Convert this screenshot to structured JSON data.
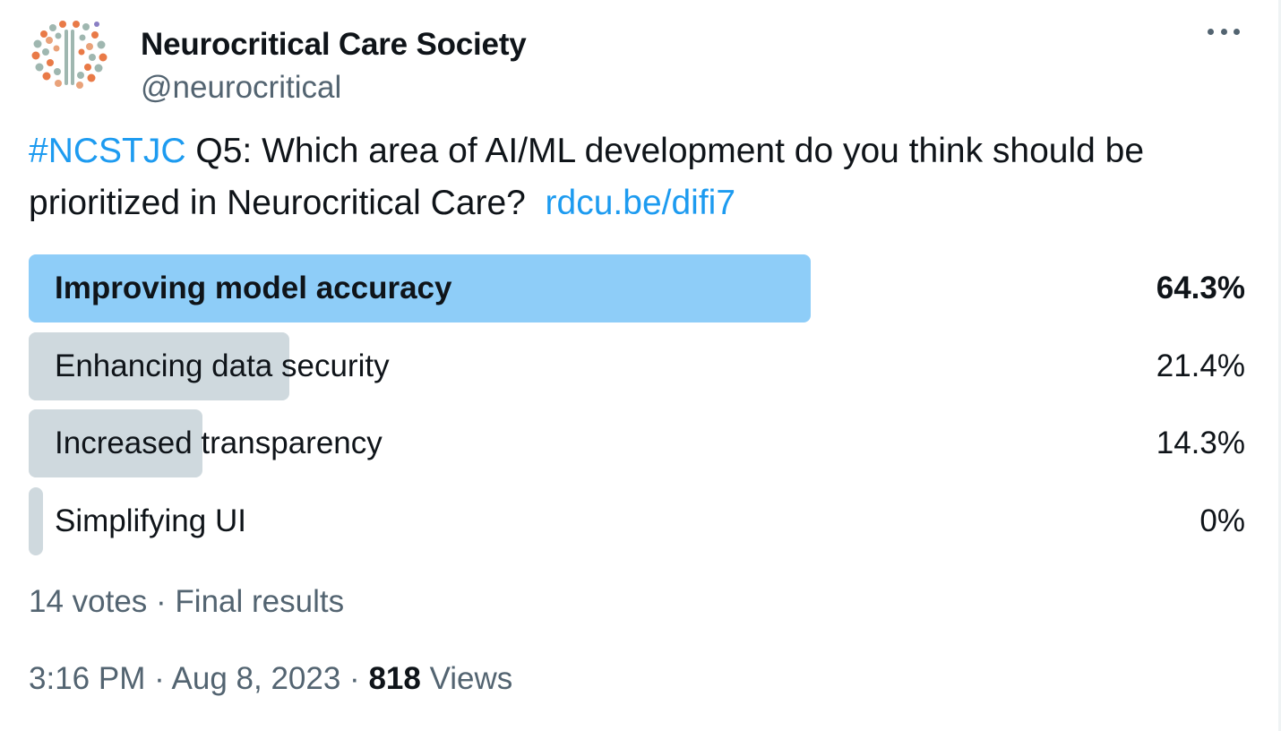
{
  "author": {
    "display_name": "Neurocritical Care Society",
    "handle": "@neurocritical",
    "avatar_icon": "brain-logo-icon"
  },
  "tweet": {
    "hashtag": "#NCSTJC",
    "text": " Q5: Which area of AI/ML development do you think should be prioritized in Neurocritical Care?  ",
    "link": "rdcu.be/difi7"
  },
  "poll": {
    "options": [
      {
        "label": "Improving model accuracy",
        "percent": "64.3%",
        "fraction": 0.643,
        "winner": true
      },
      {
        "label": "Enhancing data security",
        "percent": "21.4%",
        "fraction": 0.214,
        "winner": false
      },
      {
        "label": "Increased transparency",
        "percent": "14.3%",
        "fraction": 0.143,
        "winner": false
      },
      {
        "label": "Simplifying UI",
        "percent": "0%",
        "fraction": 0.0,
        "winner": false
      }
    ],
    "votes": "14 votes",
    "separator": " · ",
    "status": "Final results"
  },
  "meta": {
    "time": "3:16 PM",
    "separator": " · ",
    "date": "Aug 8, 2023",
    "views_count": "818",
    "views_label": " Views"
  },
  "colors": {
    "link": "#1d9bf0",
    "winner_bar": "#8ecdf8",
    "bar": "#cfd9de",
    "secondary_text": "#536471"
  }
}
